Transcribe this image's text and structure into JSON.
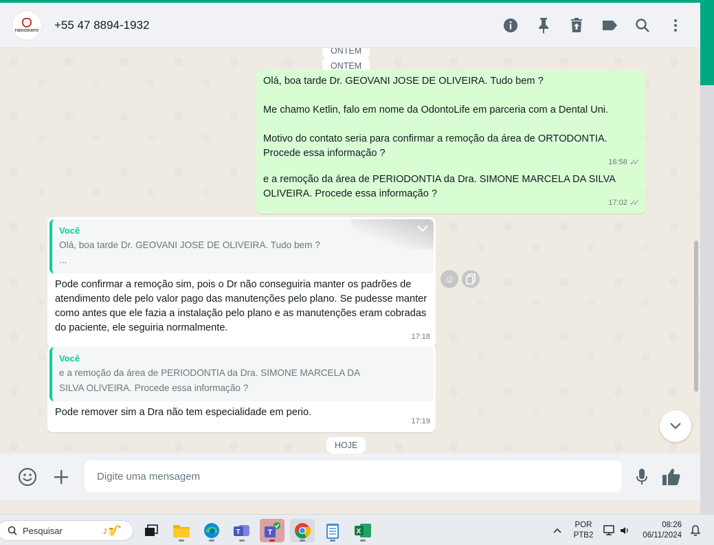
{
  "header": {
    "avatar_brand": "FISIOODONTO",
    "contact": "+55 47 8894-1932"
  },
  "chips": {
    "ontem_top": "ONTEM",
    "ontem": "ONTEM",
    "hoje": "HOJE"
  },
  "messages": [
    {
      "text": "Olá, boa tarde Dr. GEOVANI JOSE DE OLIVEIRA. Tudo bem ?\n\nMe chamo Ketlin, falo em nome da OdontoLife em parceria com a Dental Uni.\n\nMotivo do contato seria para confirmar a remoção da área de ORTODONTIA.\nProcede essa informação ?",
      "time": "16:58"
    },
    {
      "text": "e a remoção da área de PERIODONTIA da Dra. SIMONE MARCELA DA SILVA OLIVEIRA. Procede essa informação ?",
      "time": "17:02"
    },
    {
      "quote_author": "Você",
      "quote_text": "Olá, boa tarde Dr. GEOVANI JOSE DE OLIVEIRA. Tudo bem ?\n...",
      "text": "Pode confirmar a remoção sim, pois o Dr não conseguiria manter os padrões de atendimento dele pelo valor pago das manutenções pelo plano. Se pudesse manter como antes que ele fazia a instalação pelo plano e as manutenções eram cobradas do paciente, ele seguiria normalmente.",
      "time": "17:18"
    },
    {
      "quote_author": "Você",
      "quote_text": "e a remoção da área de PERIODONTIA da Dra. SIMONE MARCELA DA SILVA OLIVEIRA. Procede essa informação ?",
      "text": "Pode remover sim a Dra não tem especialidade em perio.",
      "time": "17:19"
    }
  ],
  "composer": {
    "placeholder": "Digite uma mensagem"
  },
  "taskbar": {
    "search_placeholder": "Pesquisar",
    "lang1": "POR",
    "lang2": "PTB2",
    "time": "08:26",
    "date": "06/11/2024"
  }
}
